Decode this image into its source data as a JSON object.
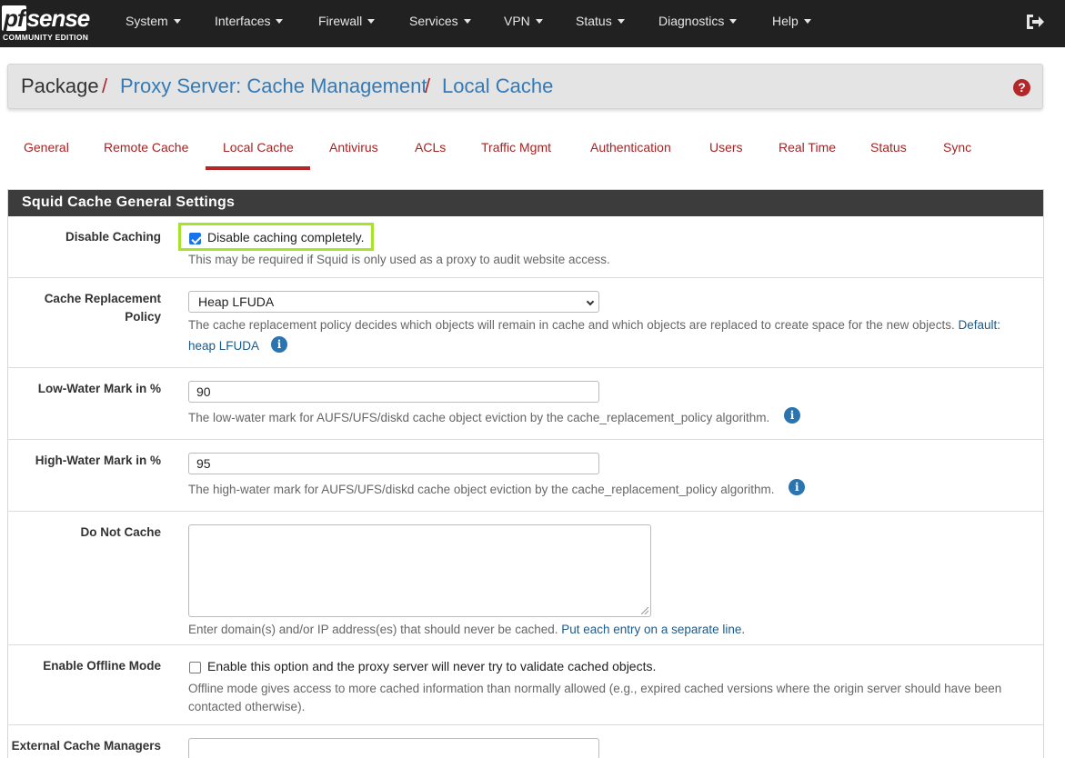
{
  "navbar": {
    "logo_brand_pf": "pf",
    "logo_brand_rest": "sense",
    "logo_edition": "COMMUNITY EDITION",
    "items": [
      {
        "label": "System"
      },
      {
        "label": "Interfaces"
      },
      {
        "label": "Firewall"
      },
      {
        "label": "Services"
      },
      {
        "label": "VPN"
      },
      {
        "label": "Status"
      },
      {
        "label": "Diagnostics"
      },
      {
        "label": "Help"
      }
    ],
    "logout_icon": "sign-out-icon"
  },
  "breadcrumb": {
    "root": "Package",
    "sep": "/",
    "level1": "Proxy Server: Cache Management",
    "level2": "Local Cache",
    "help_icon": "question-circle-icon",
    "help_glyph": "?"
  },
  "tabs": [
    {
      "label": "General"
    },
    {
      "label": "Remote Cache"
    },
    {
      "label": "Local Cache",
      "active": true
    },
    {
      "label": "Antivirus"
    },
    {
      "label": "ACLs"
    },
    {
      "label": "Traffic Mgmt"
    },
    {
      "label": "Authentication"
    },
    {
      "label": "Users"
    },
    {
      "label": "Real Time"
    },
    {
      "label": "Status"
    },
    {
      "label": "Sync"
    }
  ],
  "panel": {
    "title": "Squid Cache General Settings",
    "disable_caching": {
      "label": "Disable Caching",
      "checked": true,
      "option": "Disable caching completely.",
      "help": "This may be required if Squid is only used as a proxy to audit website access."
    },
    "replacement_policy": {
      "label_line1": "Cache Replacement",
      "label_line2": "Policy",
      "value": "Heap LFUDA",
      "help_line1": "The cache replacement policy decides which objects will remain in cache and which objects are replaced to create space for the new objects.",
      "help_default_prefix": "Default:",
      "help_default_value": "heap LFUDA"
    },
    "low_water": {
      "label": "Low-Water Mark in %",
      "value": "90",
      "help": "The low-water mark for AUFS/UFS/diskd cache object eviction by the cache_replacement_policy algorithm."
    },
    "high_water": {
      "label": "High-Water Mark in %",
      "value": "95",
      "help": "The high-water mark for AUFS/UFS/diskd cache object eviction by the cache_replacement_policy algorithm."
    },
    "do_not_cache": {
      "label": "Do Not Cache",
      "value": "",
      "help_prefix": "Enter domain(s) and/or IP address(es) that should never be cached.",
      "help_link": "Put each entry on a separate line."
    },
    "offline_mode": {
      "label": "Enable Offline Mode",
      "checked": false,
      "option": "Enable this option and the proxy server will never try to validate cached objects.",
      "help_line1": "Offline mode gives access to more cached information than normally allowed (e.g., expired cached versions where the origin server should have been",
      "help_line2": "contacted otherwise)."
    },
    "external_managers": {
      "label": "External Cache Managers",
      "value": ""
    },
    "info_glyph": "i"
  },
  "colors": {
    "navbar_bg": "#212121",
    "accent_red": "#b32728",
    "link_blue": "#337ab7",
    "panel_heading_bg": "#3c3c3c",
    "highlight_green": "#a5e32d"
  }
}
